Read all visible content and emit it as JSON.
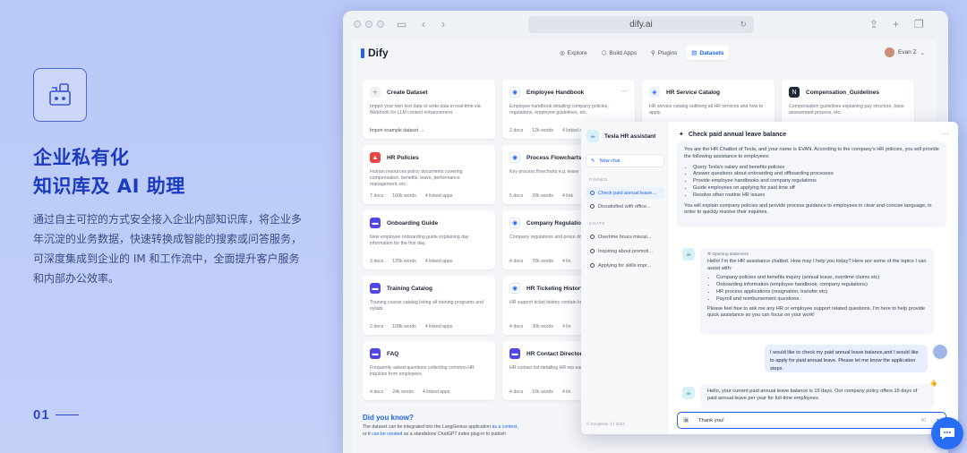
{
  "hero": {
    "title_line1": "企业私有化",
    "title_line2": "知识库及 AI 助理",
    "description": "通过自主可控的方式安全接入企业内部知识库，将企业多年沉淀的业务数据，快速转换成智能的搜索或问答服务，可深度集成到企业的 IM 和工作流中，全面提升客户服务和内部办公效率。",
    "page_number": "01"
  },
  "browser": {
    "url": "dify.ai"
  },
  "topnav": {
    "logo": "Dify",
    "tabs": [
      {
        "label": "Explore",
        "icon": "explore-icon"
      },
      {
        "label": "Build Apps",
        "icon": "apps-icon"
      },
      {
        "label": "Plugins",
        "icon": "plugin-icon"
      },
      {
        "label": "Datasets",
        "icon": "dataset-icon",
        "active": true
      }
    ],
    "user": "Evan Z"
  },
  "datasets": {
    "create": {
      "title": "Create Dataset",
      "desc": "Import your own text data or write data in real-time via Webhook for LLM context enhancement.",
      "link": "Import example dataset →"
    },
    "cards": [
      {
        "title": "Employee Handbook",
        "desc": "Employee handbook detailing company policies, regulations, employee guidelines, etc.",
        "docs": "2 docs",
        "words": "12k words",
        "apps": "4 linked apps"
      },
      {
        "title": "HR Service Catalog",
        "desc": "HR service catalog outlining all HR services and how to apply.",
        "docs": "",
        "words": "",
        "apps": ""
      },
      {
        "title": "Compensation_Guidelines",
        "desc": "Compensation guidelines explaining pay structure, base assessment process, etc.",
        "docs": "",
        "words": "",
        "apps": ""
      },
      {
        "title": "HR Policies",
        "desc": "Human resources policy documents covering compensation, benefits, leave, performance management, etc.",
        "docs": "7 docs",
        "words": "100k words",
        "apps": "4 linked apps"
      },
      {
        "title": "Process Flowcharts",
        "desc": "Key process flowcharts e.g. leave",
        "docs": "5 docs",
        "words": "20k words",
        "apps": "4 link"
      },
      {
        "title": "Onboarding Guide",
        "desc": "New employee onboarding guide explaining day information for the first day.",
        "docs": "3 docs",
        "words": "120k words",
        "apps": "4 linked apps"
      },
      {
        "title": "Company Regulation",
        "desc": "Company regulations and proce document.",
        "docs": "4 docs",
        "words": "70k words",
        "apps": "4 lin"
      },
      {
        "title": "Training Catalog",
        "desc": "Training course catalog listing all training programs and syllabi.",
        "docs": "2 docs",
        "words": "108k words",
        "apps": "4 linked apps"
      },
      {
        "title": "HR Ticketing History",
        "desc": "HR support ticket history contain knowledge base.",
        "docs": "4 docs",
        "words": "30k words",
        "apps": "4 lin"
      },
      {
        "title": "FAQ",
        "desc": "Frequently asked questions collecting common HR inquiries from employees.",
        "docs": "4 docs",
        "words": "24k words",
        "apps": "4 linked apps"
      },
      {
        "title": "HR Contact Directory",
        "desc": "HR contact list detailing HR rep each department.",
        "docs": "4 docs",
        "words": "10k words",
        "apps": "4 lin"
      }
    ]
  },
  "didyouknow": {
    "heading": "Did you know?",
    "line1_a": "The dataset can be integrated into the LangGenius application ",
    "line1_link": "as a context",
    "line1_b": ",",
    "line2_a": "or it ",
    "line2_link": "can be created",
    "line2_b": " as a standalone ChatGPT index plug-in to publish"
  },
  "chat": {
    "bot_name": "Tesla HR assistant",
    "new_chat": "New chat",
    "pinned_label": "PINNED",
    "pinned": [
      "Check paid annual leave...",
      "Dissatisfied with office..."
    ],
    "chats_label": "CHATS",
    "chats": [
      "Overtime hours miscal...",
      "Inquiring about promoti...",
      "Applying for skills impr..."
    ],
    "footer": "© Dooytelwi Ⓢr 2023",
    "title": "Check paid annual leave balance",
    "system": {
      "intro": "You are the HR Chatbot of Tesla, and your name is EVAN. According to the company's HR policies, you will provide the following assistance to employees:",
      "items": [
        "Query Tesla's salary and benefits policies",
        "Answer questions about onboarding and offboarding processes",
        "Provide employee handbooks and company regulations",
        "Guide employees on applying for paid time off",
        "Resolve other routine HR issues"
      ],
      "outro": "You will explain company policies and provide process guidance to employees in clear and concise language, in order to quickly resolve their inquiries."
    },
    "opening": {
      "label": "Opening statement",
      "intro": "Hello! I'm the HR assistance chatbot. How may I help you today? Here are some of the topics I can assist with:",
      "items": [
        "Company policies and benefits inquiry (annual leave, overtime claims etc)",
        "Onboarding information (employee handbook, company regulations)",
        "HR process applications (resignation, transfer etc)",
        "Payroll and reimbursement questions"
      ],
      "outro": "Please feel free to ask me any HR or employee support related questions. I'm here to help provide quick assistance so you can focus on your work!"
    },
    "user_message": "I would like to check my paid annual leave balance,and  I would like to apply for paid annual leave. Please let me know the application steps.",
    "answer": "Hello, your current paid annual leave balance is 15 days. Our company policy offers 15 days of paid annual leave per year for full-time employees.",
    "input_value": "Thank you!",
    "input_count": "40"
  }
}
